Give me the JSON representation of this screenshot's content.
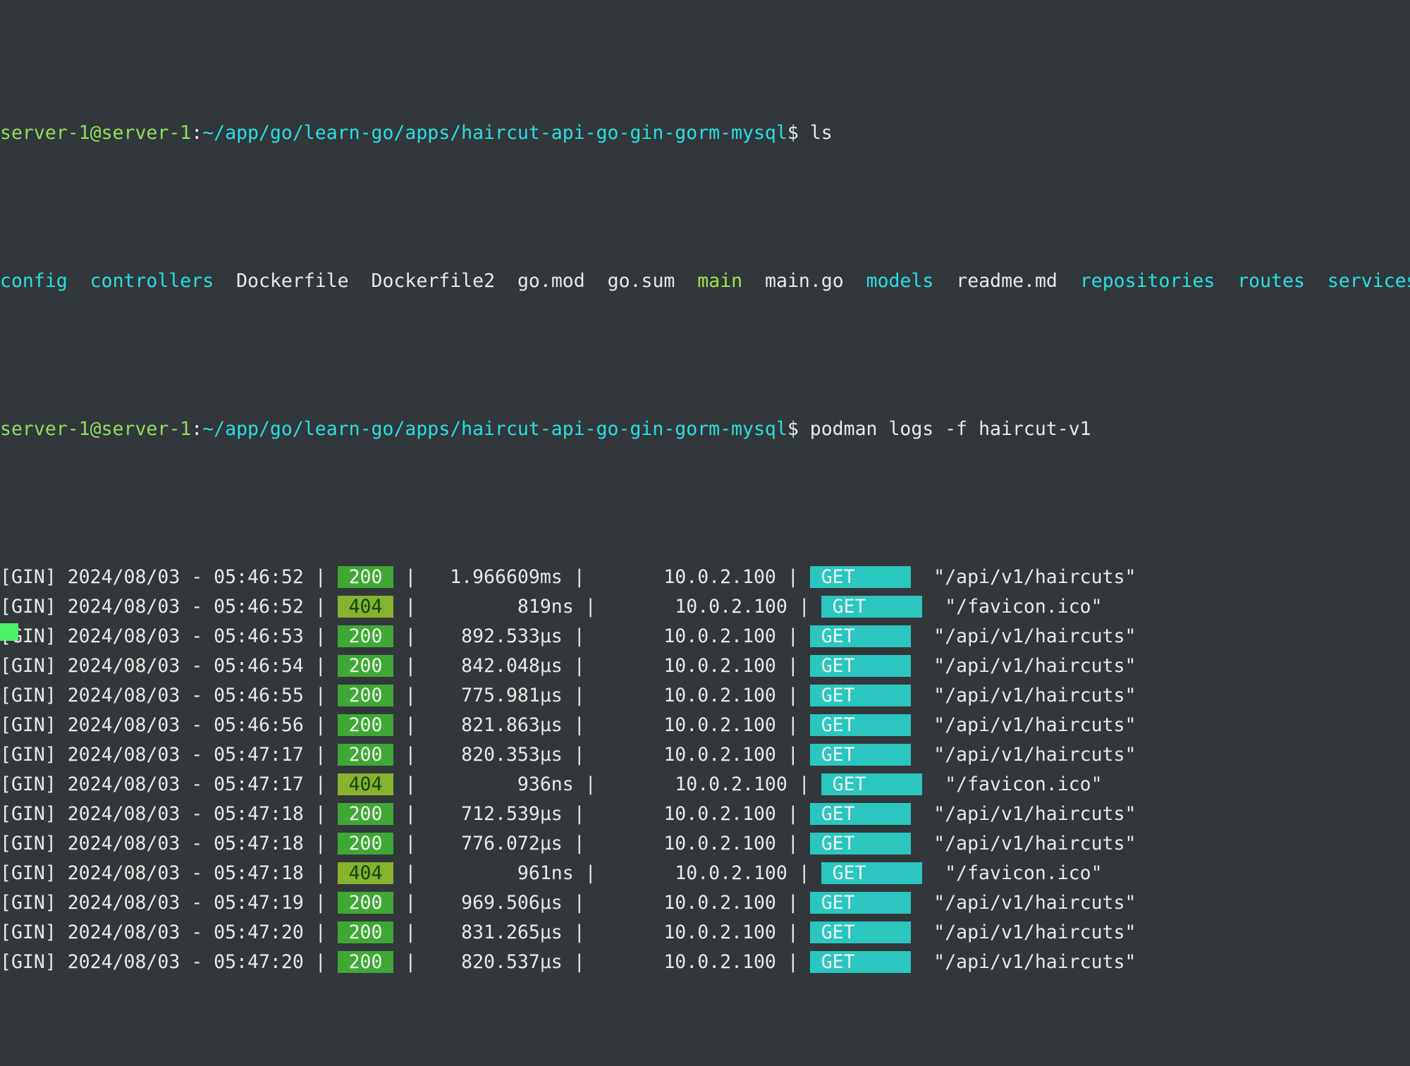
{
  "terminal": {
    "background_color": "#32373b",
    "foreground_color": "#e6ece6",
    "prompt_user_host_color": "#8fe05a",
    "prompt_path_color": "#2ae0e0",
    "badge_200_bg": "#3fa835",
    "badge_404_bg": "#86b22e",
    "badge_get_bg": "#2bc6c0"
  },
  "prompt1": {
    "user_host": "server-1@server-1",
    "colon": ":",
    "path": "~/app/go/learn-go/apps/haircut-api-go-gin-gorm-mysql",
    "dollar": "$ ",
    "command": "ls"
  },
  "ls_output": {
    "entries": [
      {
        "name": "config",
        "type": "dir"
      },
      {
        "name": "controllers",
        "type": "dir"
      },
      {
        "name": "Dockerfile",
        "type": "file"
      },
      {
        "name": "Dockerfile2",
        "type": "file"
      },
      {
        "name": "go.mod",
        "type": "file"
      },
      {
        "name": "go.sum",
        "type": "file"
      },
      {
        "name": "main",
        "type": "exec"
      },
      {
        "name": "main.go",
        "type": "file"
      },
      {
        "name": "models",
        "type": "dir"
      },
      {
        "name": "readme.md",
        "type": "file"
      },
      {
        "name": "repositories",
        "type": "dir"
      },
      {
        "name": "routes",
        "type": "dir"
      },
      {
        "name": "services",
        "type": "dir"
      }
    ],
    "line_text": "config  controllers  Dockerfile  Dockerfile2  go.mod  go.sum  main  main.go  models  readme.md  repositories  routes  services"
  },
  "prompt2": {
    "user_host": "server-1@server-1",
    "colon": ":",
    "path": "~/app/go/learn-go/apps/haircut-api-go-gin-gorm-mysql",
    "dollar": "$ ",
    "command": "podman logs -f haircut-v1"
  },
  "log": {
    "tag": "[GIN]",
    "rows": [
      {
        "prefix": "[GIN] 2024/08/03 - 05:46:52 | ",
        "status": "200",
        "status_kind": "ok",
        "mid": " |   1.966609ms |       10.0.2.100 | ",
        "method": "GET",
        "suffix": "  \"/api/v1/haircuts\""
      },
      {
        "prefix": "[GIN] 2024/08/03 - 05:46:52 | ",
        "status": "404",
        "status_kind": "warn",
        "mid": " |         819ns |       10.0.2.100 | ",
        "method": "GET",
        "suffix": "  \"/favicon.ico\""
      },
      {
        "prefix": "[GIN] 2024/08/03 - 05:46:53 | ",
        "status": "200",
        "status_kind": "ok",
        "mid": " |    892.533µs |       10.0.2.100 | ",
        "method": "GET",
        "suffix": "  \"/api/v1/haircuts\""
      },
      {
        "prefix": "[GIN] 2024/08/03 - 05:46:54 | ",
        "status": "200",
        "status_kind": "ok",
        "mid": " |    842.048µs |       10.0.2.100 | ",
        "method": "GET",
        "suffix": "  \"/api/v1/haircuts\""
      },
      {
        "prefix": "[GIN] 2024/08/03 - 05:46:55 | ",
        "status": "200",
        "status_kind": "ok",
        "mid": " |    775.981µs |       10.0.2.100 | ",
        "method": "GET",
        "suffix": "  \"/api/v1/haircuts\""
      },
      {
        "prefix": "[GIN] 2024/08/03 - 05:46:56 | ",
        "status": "200",
        "status_kind": "ok",
        "mid": " |    821.863µs |       10.0.2.100 | ",
        "method": "GET",
        "suffix": "  \"/api/v1/haircuts\""
      },
      {
        "prefix": "[GIN] 2024/08/03 - 05:47:17 | ",
        "status": "200",
        "status_kind": "ok",
        "mid": " |    820.353µs |       10.0.2.100 | ",
        "method": "GET",
        "suffix": "  \"/api/v1/haircuts\""
      },
      {
        "prefix": "[GIN] 2024/08/03 - 05:47:17 | ",
        "status": "404",
        "status_kind": "warn",
        "mid": " |         936ns |       10.0.2.100 | ",
        "method": "GET",
        "suffix": "  \"/favicon.ico\""
      },
      {
        "prefix": "[GIN] 2024/08/03 - 05:47:18 | ",
        "status": "200",
        "status_kind": "ok",
        "mid": " |    712.539µs |       10.0.2.100 | ",
        "method": "GET",
        "suffix": "  \"/api/v1/haircuts\""
      },
      {
        "prefix": "[GIN] 2024/08/03 - 05:47:18 | ",
        "status": "200",
        "status_kind": "ok",
        "mid": " |    776.072µs |       10.0.2.100 | ",
        "method": "GET",
        "suffix": "  \"/api/v1/haircuts\""
      },
      {
        "prefix": "[GIN] 2024/08/03 - 05:47:18 | ",
        "status": "404",
        "status_kind": "warn",
        "mid": " |         961ns |       10.0.2.100 | ",
        "method": "GET",
        "suffix": "  \"/favicon.ico\""
      },
      {
        "prefix": "[GIN] 2024/08/03 - 05:47:19 | ",
        "status": "200",
        "status_kind": "ok",
        "mid": " |    969.506µs |       10.0.2.100 | ",
        "method": "GET",
        "suffix": "  \"/api/v1/haircuts\""
      },
      {
        "prefix": "[GIN] 2024/08/03 - 05:47:20 | ",
        "status": "200",
        "status_kind": "ok",
        "mid": " |    831.265µs |       10.0.2.100 | ",
        "method": "GET",
        "suffix": "  \"/api/v1/haircuts\""
      },
      {
        "prefix": "[GIN] 2024/08/03 - 05:47:20 | ",
        "status": "200",
        "status_kind": "ok",
        "mid": " |    820.537µs |       10.0.2.100 | ",
        "method": "GET",
        "suffix": "  \"/api/v1/haircuts\""
      }
    ]
  },
  "cursor": {
    "visible": true,
    "color": "#4df06a"
  }
}
